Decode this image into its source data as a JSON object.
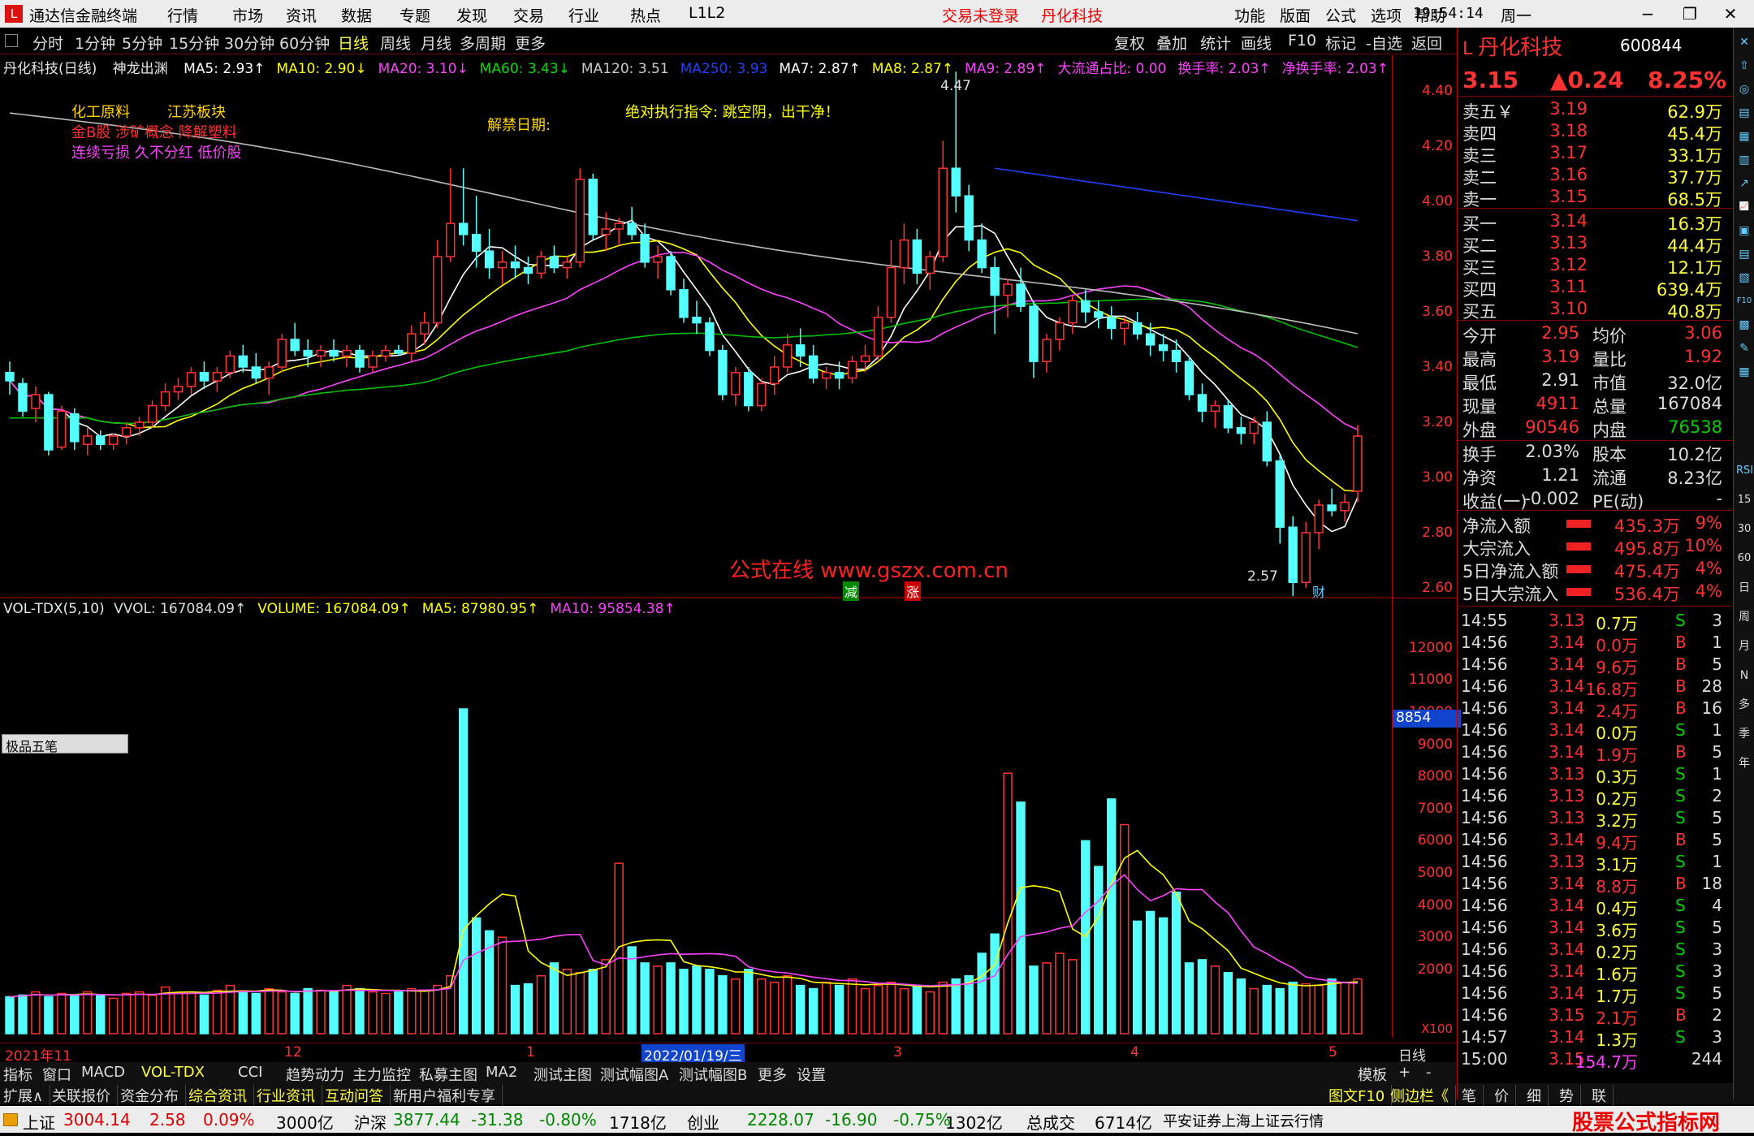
{
  "titlebar": {
    "app_title": "通达信金融终端",
    "menus": [
      "行情",
      "市场",
      "资讯",
      "数据",
      "专题",
      "发现",
      "交易",
      "行业",
      "热点",
      "L1L2"
    ],
    "notice_login": "交易未登录",
    "notice_stock": "丹化科技",
    "right_menus": [
      "功能",
      "版面",
      "公式",
      "选项",
      "帮助"
    ],
    "clock": "19:54:14",
    "weekday": "周一"
  },
  "periods": [
    "分时",
    "1分钟",
    "5分钟",
    "15分钟",
    "30分钟",
    "60分钟",
    "日线",
    "周线",
    "月线",
    "多周期",
    "更多"
  ],
  "active_period": "日线",
  "tools": [
    "复权",
    "叠加",
    "统计",
    "画线",
    "F10",
    "标记",
    "-自选",
    "返回"
  ],
  "price_header": {
    "stock": "丹化科技(日线)",
    "indicator": "神龙出渊",
    "items": [
      {
        "text": "MA5: 2.93↑",
        "color": "#ffffff"
      },
      {
        "text": "MA10: 2.90↓",
        "color": "#ffff00"
      },
      {
        "text": "MA20: 3.10↓",
        "color": "#ff40ff"
      },
      {
        "text": "MA60: 3.43↓",
        "color": "#00e000"
      },
      {
        "text": "MA120: 3.51",
        "color": "#cccccc"
      },
      {
        "text": "MA250: 3.93",
        "color": "#2040ff"
      },
      {
        "text": "MA7: 2.87↑",
        "color": "#ffffff"
      },
      {
        "text": "MA8: 2.87↑",
        "color": "#ffff00"
      },
      {
        "text": "MA9: 2.89↑",
        "color": "#ff40ff"
      },
      {
        "text": "大流通占比: 0.00",
        "color": "#ff40ff"
      },
      {
        "text": "换手率: 2.03↑",
        "color": "#ff40ff"
      },
      {
        "text": "净换手率: 2.03↑",
        "color": "#ff40ff"
      }
    ]
  },
  "chart_notes": {
    "sector1": "化工原料",
    "sector2": "江苏板块",
    "concepts": "金B股 涉矿概念 降解塑料",
    "tags": "连续亏损 久不分红 低价股",
    "unlock": "解禁日期:",
    "command": "绝对执行指令:   跳空阴，出干净！",
    "watermark": "公式在线  www.gszx.com.cn",
    "high_label": "4.47",
    "low_label": "2.57",
    "mark_reduce": "减",
    "mark_rise": "涨",
    "mark_fin": "财"
  },
  "price_axis": [
    "4.40",
    "4.20",
    "4.00",
    "3.80",
    "3.60",
    "3.40",
    "3.20",
    "3.00",
    "2.80",
    "2.60"
  ],
  "vol_header": {
    "name": "VOL-TDX(5,10)",
    "items": [
      {
        "text": "VVOL: 167084.09↑",
        "color": "#dddddd"
      },
      {
        "text": "VOLUME: 167084.09↑",
        "color": "#ffff00"
      },
      {
        "text": "MA5: 87980.95↑",
        "color": "#ffff00"
      },
      {
        "text": "MA10: 95854.38↑",
        "color": "#ff40ff"
      }
    ]
  },
  "vol_axis": [
    "12000",
    "11000",
    "10000",
    "9000",
    "8000",
    "7000",
    "6000",
    "5000",
    "4000",
    "3000",
    "2000"
  ],
  "vol_axis_badge": "8854",
  "vol_axis_unit": "X100",
  "drawing_tool": "极品五笔",
  "date_axis": [
    "2021年11",
    "12",
    "1",
    "2022/01/19/三",
    "3",
    "4",
    "5"
  ],
  "date_axis_right": "日线",
  "bottom_tabs": [
    "指标",
    "窗口",
    "MACD",
    "VOL-TDX",
    "CCI",
    "趋势动力",
    "主力监控",
    "私募主图",
    "MA2",
    "测试主图",
    "测试幅图A",
    "测试幅图B",
    "更多",
    "设置"
  ],
  "bottom_tabs_right": [
    "模板",
    "+",
    "-"
  ],
  "tabs2": [
    "扩展∧",
    "关联报价",
    "资金分布",
    "综合资讯",
    "行业资讯",
    "互动问答",
    "新用户福利专享"
  ],
  "tabs2_right": [
    "图文F10",
    "侧边栏《",
    "笔",
    "价",
    "细",
    "势",
    "联"
  ],
  "quote": {
    "name": "丹化科技",
    "code": "600844",
    "price": "3.15",
    "change": "▲0.24",
    "pct": "8.25%",
    "asks": [
      {
        "label": "卖五￥",
        "price": "3.19",
        "vol": "62.9万"
      },
      {
        "label": "卖四",
        "price": "3.18",
        "vol": "45.4万"
      },
      {
        "label": "卖三",
        "price": "3.17",
        "vol": "33.1万"
      },
      {
        "label": "卖二",
        "price": "3.16",
        "vol": "37.7万"
      },
      {
        "label": "卖一",
        "price": "3.15",
        "vol": "68.5万"
      }
    ],
    "bids": [
      {
        "label": "买一",
        "price": "3.14",
        "vol": "16.3万"
      },
      {
        "label": "买二",
        "price": "3.13",
        "vol": "44.4万"
      },
      {
        "label": "买三",
        "price": "3.12",
        "vol": "12.1万"
      },
      {
        "label": "买四",
        "price": "3.11",
        "vol": "639.4万"
      },
      {
        "label": "买五",
        "price": "3.10",
        "vol": "40.8万"
      }
    ],
    "stats1": [
      {
        "l1": "今开",
        "v1": "2.95",
        "l2": "均价",
        "v2": "3.06"
      },
      {
        "l1": "最高",
        "v1": "3.19",
        "l2": "量比",
        "v2": "1.92"
      },
      {
        "l1": "最低",
        "v1": "2.91",
        "l2": "市值",
        "v2": "32.0亿"
      },
      {
        "l1": "现量",
        "v1": "4911",
        "l2": "总量",
        "v2": "167084"
      },
      {
        "l1": "外盘",
        "v1": "90546",
        "l2": "内盘",
        "v2": "76538"
      }
    ],
    "stats2": [
      {
        "l1": "换手",
        "v1": "2.03%",
        "l2": "股本",
        "v2": "10.2亿"
      },
      {
        "l1": "净资",
        "v1": "1.21",
        "l2": "流通",
        "v2": "8.23亿"
      },
      {
        "l1": "收益(一)",
        "v1": "-0.002",
        "l2": "PE(动)",
        "v2": "-"
      }
    ],
    "flows": [
      {
        "label": "净流入额",
        "val": "435.3万",
        "pct": "9%"
      },
      {
        "label": "大宗流入",
        "val": "495.8万",
        "pct": "10%"
      },
      {
        "label": "5日净流入额",
        "val": "475.4万",
        "pct": "4%"
      },
      {
        "label": "5日大宗流入",
        "val": "536.4万",
        "pct": "4%"
      }
    ],
    "ticks": [
      {
        "t": "14:55",
        "p": "3.13",
        "v": "0.7万",
        "s": "S",
        "n": "3"
      },
      {
        "t": "14:56",
        "p": "3.14",
        "v": "0.0万",
        "s": "B",
        "n": "1"
      },
      {
        "t": "14:56",
        "p": "3.14",
        "v": "9.6万",
        "s": "B",
        "n": "5"
      },
      {
        "t": "14:56",
        "p": "3.14",
        "v": "16.8万",
        "s": "B",
        "n": "28"
      },
      {
        "t": "14:56",
        "p": "3.14",
        "v": "2.4万",
        "s": "B",
        "n": "16"
      },
      {
        "t": "14:56",
        "p": "3.14",
        "v": "0.0万",
        "s": "S",
        "n": "1"
      },
      {
        "t": "14:56",
        "p": "3.14",
        "v": "1.9万",
        "s": "B",
        "n": "5"
      },
      {
        "t": "14:56",
        "p": "3.13",
        "v": "0.3万",
        "s": "S",
        "n": "1"
      },
      {
        "t": "14:56",
        "p": "3.13",
        "v": "0.2万",
        "s": "S",
        "n": "2"
      },
      {
        "t": "14:56",
        "p": "3.13",
        "v": "3.2万",
        "s": "S",
        "n": "5"
      },
      {
        "t": "14:56",
        "p": "3.14",
        "v": "9.4万",
        "s": "B",
        "n": "5"
      },
      {
        "t": "14:56",
        "p": "3.13",
        "v": "3.1万",
        "s": "S",
        "n": "1"
      },
      {
        "t": "14:56",
        "p": "3.14",
        "v": "8.8万",
        "s": "B",
        "n": "18"
      },
      {
        "t": "14:56",
        "p": "3.14",
        "v": "0.4万",
        "s": "S",
        "n": "4"
      },
      {
        "t": "14:56",
        "p": "3.14",
        "v": "3.6万",
        "s": "S",
        "n": "5"
      },
      {
        "t": "14:56",
        "p": "3.14",
        "v": "0.2万",
        "s": "S",
        "n": "3"
      },
      {
        "t": "14:56",
        "p": "3.14",
        "v": "1.6万",
        "s": "S",
        "n": "3"
      },
      {
        "t": "14:56",
        "p": "3.14",
        "v": "1.7万",
        "s": "S",
        "n": "5"
      },
      {
        "t": "14:56",
        "p": "3.15",
        "v": "2.1万",
        "s": "B",
        "n": "2"
      },
      {
        "t": "14:57",
        "p": "3.14",
        "v": "1.3万",
        "s": "S",
        "n": "3"
      },
      {
        "t": "15:00",
        "p": "3.15",
        "v": "154.7万",
        "s": "",
        "n": "244"
      }
    ]
  },
  "sidebar_labels": [
    "RSI",
    "15",
    "30",
    "60",
    "日",
    "周",
    "月",
    "N",
    "多",
    "季",
    "年"
  ],
  "statusbar": {
    "items": [
      {
        "text": "上证",
        "color": "#000"
      },
      {
        "text": "3004.14",
        "color": "#d00"
      },
      {
        "text": "2.58",
        "color": "#d00"
      },
      {
        "text": "0.09%",
        "color": "#d00"
      },
      {
        "text": "3000亿",
        "color": "#000"
      },
      {
        "text": "沪深",
        "color": "#000"
      },
      {
        "text": "3877.44",
        "color": "#080"
      },
      {
        "text": "-31.38",
        "color": "#080"
      },
      {
        "text": "-0.80%",
        "color": "#080"
      },
      {
        "text": "1718亿",
        "color": "#000"
      },
      {
        "text": "创业",
        "color": "#000"
      },
      {
        "text": "2228.07",
        "color": "#080"
      },
      {
        "text": "-16.90",
        "color": "#080"
      },
      {
        "text": "-0.75%",
        "color": "#080"
      },
      {
        "text": "1302亿",
        "color": "#000"
      },
      {
        "text": "总成交",
        "color": "#000"
      },
      {
        "text": "6714亿",
        "color": "#000"
      },
      {
        "text": "平安证券上海上证云行情",
        "color": "#000"
      }
    ],
    "brand": "股票公式指标网",
    "brand_url": "www.gszx.com.cn"
  },
  "chart_data": {
    "type": "candlestick",
    "price_range": [
      2.5,
      4.5
    ],
    "volume_range": [
      0,
      12500
    ],
    "candles": [
      [
        3.38,
        3.42,
        3.3,
        3.35
      ],
      [
        3.34,
        3.36,
        3.22,
        3.24
      ],
      [
        3.25,
        3.33,
        3.2,
        3.3
      ],
      [
        3.3,
        3.31,
        3.08,
        3.1
      ],
      [
        3.11,
        3.26,
        3.1,
        3.24
      ],
      [
        3.23,
        3.25,
        3.1,
        3.13
      ],
      [
        3.12,
        3.18,
        3.08,
        3.15
      ],
      [
        3.15,
        3.17,
        3.1,
        3.12
      ],
      [
        3.12,
        3.16,
        3.1,
        3.15
      ],
      [
        3.15,
        3.2,
        3.12,
        3.18
      ],
      [
        3.18,
        3.22,
        3.15,
        3.2
      ],
      [
        3.2,
        3.28,
        3.18,
        3.26
      ],
      [
        3.26,
        3.34,
        3.24,
        3.31
      ],
      [
        3.31,
        3.36,
        3.28,
        3.33
      ],
      [
        3.33,
        3.4,
        3.3,
        3.38
      ],
      [
        3.38,
        3.42,
        3.32,
        3.35
      ],
      [
        3.35,
        3.4,
        3.31,
        3.38
      ],
      [
        3.38,
        3.46,
        3.36,
        3.44
      ],
      [
        3.44,
        3.48,
        3.38,
        3.4
      ],
      [
        3.4,
        3.45,
        3.34,
        3.36
      ],
      [
        3.36,
        3.42,
        3.3,
        3.4
      ],
      [
        3.4,
        3.52,
        3.38,
        3.5
      ],
      [
        3.5,
        3.56,
        3.44,
        3.46
      ],
      [
        3.46,
        3.5,
        3.4,
        3.44
      ],
      [
        3.44,
        3.48,
        3.4,
        3.46
      ],
      [
        3.46,
        3.5,
        3.42,
        3.44
      ],
      [
        3.44,
        3.48,
        3.4,
        3.46
      ],
      [
        3.46,
        3.48,
        3.38,
        3.4
      ],
      [
        3.4,
        3.46,
        3.38,
        3.44
      ],
      [
        3.44,
        3.48,
        3.42,
        3.46
      ],
      [
        3.46,
        3.48,
        3.44,
        3.45
      ],
      [
        3.45,
        3.55,
        3.42,
        3.52
      ],
      [
        3.52,
        3.6,
        3.48,
        3.56
      ],
      [
        3.56,
        3.86,
        3.54,
        3.8
      ],
      [
        3.8,
        4.12,
        3.78,
        3.92
      ],
      [
        3.92,
        4.12,
        3.84,
        3.88
      ],
      [
        3.88,
        4.02,
        3.76,
        3.82
      ],
      [
        3.82,
        3.9,
        3.72,
        3.76
      ],
      [
        3.76,
        3.82,
        3.7,
        3.78
      ],
      [
        3.78,
        3.84,
        3.72,
        3.76
      ],
      [
        3.76,
        3.8,
        3.7,
        3.74
      ],
      [
        3.74,
        3.82,
        3.72,
        3.8
      ],
      [
        3.8,
        3.84,
        3.74,
        3.76
      ],
      [
        3.76,
        3.8,
        3.72,
        3.78
      ],
      [
        3.78,
        4.12,
        3.76,
        4.08
      ],
      [
        4.08,
        4.1,
        3.86,
        3.88
      ],
      [
        3.88,
        3.96,
        3.82,
        3.9
      ],
      [
        3.9,
        3.94,
        3.84,
        3.92
      ],
      [
        3.92,
        3.98,
        3.86,
        3.88
      ],
      [
        3.88,
        3.92,
        3.76,
        3.78
      ],
      [
        3.78,
        3.84,
        3.72,
        3.8
      ],
      [
        3.8,
        3.82,
        3.66,
        3.68
      ],
      [
        3.68,
        3.72,
        3.56,
        3.58
      ],
      [
        3.58,
        3.64,
        3.52,
        3.56
      ],
      [
        3.56,
        3.58,
        3.44,
        3.46
      ],
      [
        3.46,
        3.48,
        3.28,
        3.3
      ],
      [
        3.3,
        3.4,
        3.26,
        3.38
      ],
      [
        3.38,
        3.4,
        3.24,
        3.26
      ],
      [
        3.26,
        3.36,
        3.24,
        3.34
      ],
      [
        3.34,
        3.44,
        3.3,
        3.4
      ],
      [
        3.4,
        3.52,
        3.38,
        3.48
      ],
      [
        3.48,
        3.54,
        3.4,
        3.44
      ],
      [
        3.44,
        3.48,
        3.34,
        3.36
      ],
      [
        3.36,
        3.4,
        3.32,
        3.38
      ],
      [
        3.38,
        3.42,
        3.32,
        3.36
      ],
      [
        3.36,
        3.44,
        3.34,
        3.42
      ],
      [
        3.42,
        3.48,
        3.38,
        3.44
      ],
      [
        3.44,
        3.62,
        3.42,
        3.58
      ],
      [
        3.58,
        3.86,
        3.56,
        3.76
      ],
      [
        3.76,
        3.92,
        3.7,
        3.86
      ],
      [
        3.86,
        3.9,
        3.7,
        3.74
      ],
      [
        3.74,
        3.82,
        3.68,
        3.8
      ],
      [
        3.8,
        4.22,
        3.78,
        4.12
      ],
      [
        4.12,
        4.47,
        3.96,
        4.02
      ],
      [
        4.02,
        4.06,
        3.82,
        3.86
      ],
      [
        3.86,
        3.92,
        3.74,
        3.76
      ],
      [
        3.76,
        3.8,
        3.52,
        3.66
      ],
      [
        3.66,
        3.72,
        3.58,
        3.7
      ],
      [
        3.7,
        3.76,
        3.6,
        3.62
      ],
      [
        3.62,
        3.64,
        3.36,
        3.42
      ],
      [
        3.42,
        3.52,
        3.38,
        3.5
      ],
      [
        3.5,
        3.58,
        3.46,
        3.56
      ],
      [
        3.56,
        3.66,
        3.52,
        3.64
      ],
      [
        3.64,
        3.68,
        3.56,
        3.6
      ],
      [
        3.6,
        3.64,
        3.54,
        3.58
      ],
      [
        3.58,
        3.62,
        3.5,
        3.54
      ],
      [
        3.54,
        3.58,
        3.48,
        3.56
      ],
      [
        3.56,
        3.6,
        3.5,
        3.52
      ],
      [
        3.52,
        3.56,
        3.44,
        3.48
      ],
      [
        3.48,
        3.52,
        3.42,
        3.46
      ],
      [
        3.46,
        3.5,
        3.38,
        3.42
      ],
      [
        3.42,
        3.44,
        3.28,
        3.3
      ],
      [
        3.3,
        3.34,
        3.2,
        3.24
      ],
      [
        3.24,
        3.28,
        3.18,
        3.26
      ],
      [
        3.26,
        3.28,
        3.16,
        3.18
      ],
      [
        3.18,
        3.22,
        3.12,
        3.16
      ],
      [
        3.16,
        3.22,
        3.12,
        3.2
      ],
      [
        3.2,
        3.24,
        3.04,
        3.06
      ],
      [
        3.06,
        3.08,
        2.76,
        2.82
      ],
      [
        2.82,
        2.86,
        2.57,
        2.62
      ],
      [
        2.62,
        2.84,
        2.6,
        2.8
      ],
      [
        2.8,
        2.92,
        2.74,
        2.9
      ],
      [
        2.9,
        2.96,
        2.86,
        2.88
      ],
      [
        2.88,
        2.94,
        2.84,
        2.91
      ],
      [
        2.95,
        3.19,
        2.91,
        3.15
      ]
    ],
    "volumes": [
      1150,
      1200,
      1300,
      1150,
      1250,
      1180,
      1300,
      1200,
      1100,
      1250,
      1300,
      1200,
      1450,
      1250,
      1300,
      1200,
      1350,
      1500,
      1300,
      1250,
      1400,
      1300,
      1250,
      1400,
      1350,
      1300,
      1500,
      1400,
      1300,
      1250,
      1300,
      1400,
      1350,
      1500,
      1800,
      10100,
      3600,
      3200,
      3000,
      1500,
      1550,
      1800,
      2200,
      2000,
      1900,
      2000,
      2300,
      5300,
      2700,
      2200,
      2100,
      2200,
      2000,
      2100,
      2000,
      1800,
      1700,
      2000,
      1700,
      1600,
      1800,
      1500,
      1400,
      1600,
      1500,
      1700,
      1400,
      1500,
      1600,
      1400,
      1500,
      1300,
      1600,
      1700,
      1800,
      2500,
      3100,
      8100,
      7200,
      2100,
      2200,
      2500,
      2300,
      6000,
      5200,
      7300,
      6500,
      3500,
      3800,
      3600,
      4400,
      2200,
      2300,
      2100,
      1900,
      1700,
      1400,
      1500,
      1400,
      1600,
      1550,
      1500,
      1700,
      1600,
      1700
    ]
  }
}
